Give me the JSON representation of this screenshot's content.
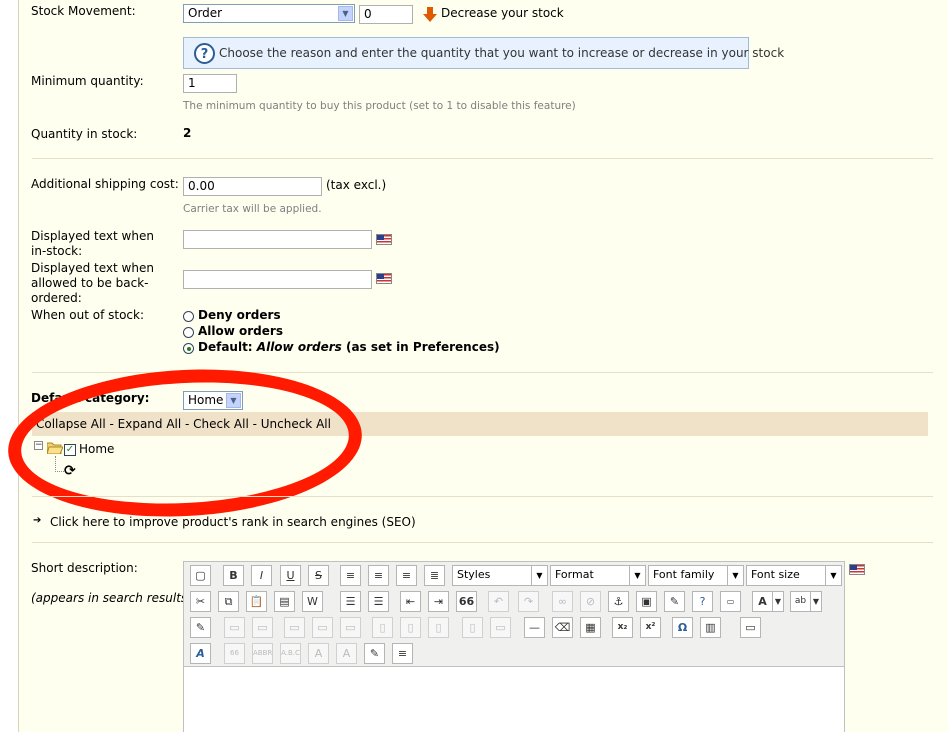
{
  "stock": {
    "label": "Stock Movement:",
    "reason_value": "Order",
    "qty_value": "0",
    "direction_label": "Decrease your stock",
    "info_text": "Choose the reason and enter the quantity that you want to increase or decrease in your stock"
  },
  "min_qty": {
    "label": "Minimum quantity:",
    "value": "1",
    "hint": "The minimum quantity to buy this product (set to 1 to disable this feature)"
  },
  "qty_in_stock": {
    "label": "Quantity in stock:",
    "value": "2"
  },
  "shipping": {
    "label": "Additional shipping cost:",
    "value": "0.00",
    "suffix": "(tax excl.)",
    "hint": "Carrier tax will be applied."
  },
  "text_in_stock": {
    "label": "Displayed text when in-stock:",
    "value": ""
  },
  "text_backorder": {
    "label": "Displayed text when allowed to be back-ordered:",
    "value": ""
  },
  "out_of_stock": {
    "label": "When out of stock:",
    "deny": "Deny orders",
    "allow": "Allow orders",
    "default_prefix": "Default:",
    "default_value": "Allow orders",
    "default_suffix": "(as set in Preferences)"
  },
  "category": {
    "label": "Default category:",
    "value": "Home",
    "tree_actions": "Collapse All - Expand All - Check All - Uncheck All",
    "tree_item": "Home"
  },
  "seo_link": "Click here to improve product's rank in search engines (SEO)",
  "short_desc": {
    "label": "Short description:",
    "note": "(appears in search results)"
  },
  "editor": {
    "styles": "Styles",
    "format": "Format",
    "font_family": "Font family",
    "font_size": "Font size",
    "bold": "B",
    "italic": "I",
    "underline": "U",
    "strike": "S",
    "quote": "66",
    "sub": "x₂",
    "sup": "x²",
    "omega": "Ω"
  },
  "colors": {
    "annotation_ring": "#ff1a00",
    "panel_bg": "#fffff0",
    "info_bg": "#e8f2ff",
    "tree_bar": "#f0e2c8"
  }
}
